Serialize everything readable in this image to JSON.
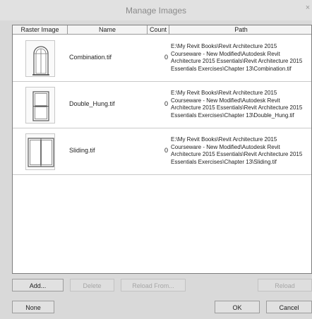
{
  "window": {
    "title": "Manage Images",
    "close_glyph": "×"
  },
  "table": {
    "columns": [
      "Raster Image",
      "Name",
      "Count",
      "Path"
    ],
    "rows": [
      {
        "thumbnail": "arched-window-icon",
        "name": "Combination.tif",
        "count": "0",
        "path": "E:\\My Revit Books\\Revit Architecture 2015\nCourseware - New Modified\\Autodesk Revit\nArchitecture 2015 Essentials\\Revit Architecture 2015\nEssentials Exercises\\Chapter 13\\Combination.tif"
      },
      {
        "thumbnail": "double-hung-window-icon",
        "name": "Double_Hung.tif",
        "count": "0",
        "path": "E:\\My Revit Books\\Revit Architecture 2015\nCourseware - New Modified\\Autodesk Revit\nArchitecture 2015 Essentials\\Revit Architecture 2015\nEssentials Exercises\\Chapter 13\\Double_Hung.tif"
      },
      {
        "thumbnail": "sliding-window-icon",
        "name": "Sliding.tif",
        "count": "0",
        "path": "E:\\My Revit Books\\Revit Architecture 2015\nCourseware - New Modified\\Autodesk Revit\nArchitecture 2015 Essentials\\Revit Architecture 2015\nEssentials Exercises\\Chapter 13\\Sliding.tif"
      }
    ]
  },
  "buttons": {
    "add": "Add...",
    "delete": "Delete",
    "reload_from": "Reload From...",
    "reload": "Reload",
    "none": "None",
    "ok": "OK",
    "cancel": "Cancel"
  }
}
